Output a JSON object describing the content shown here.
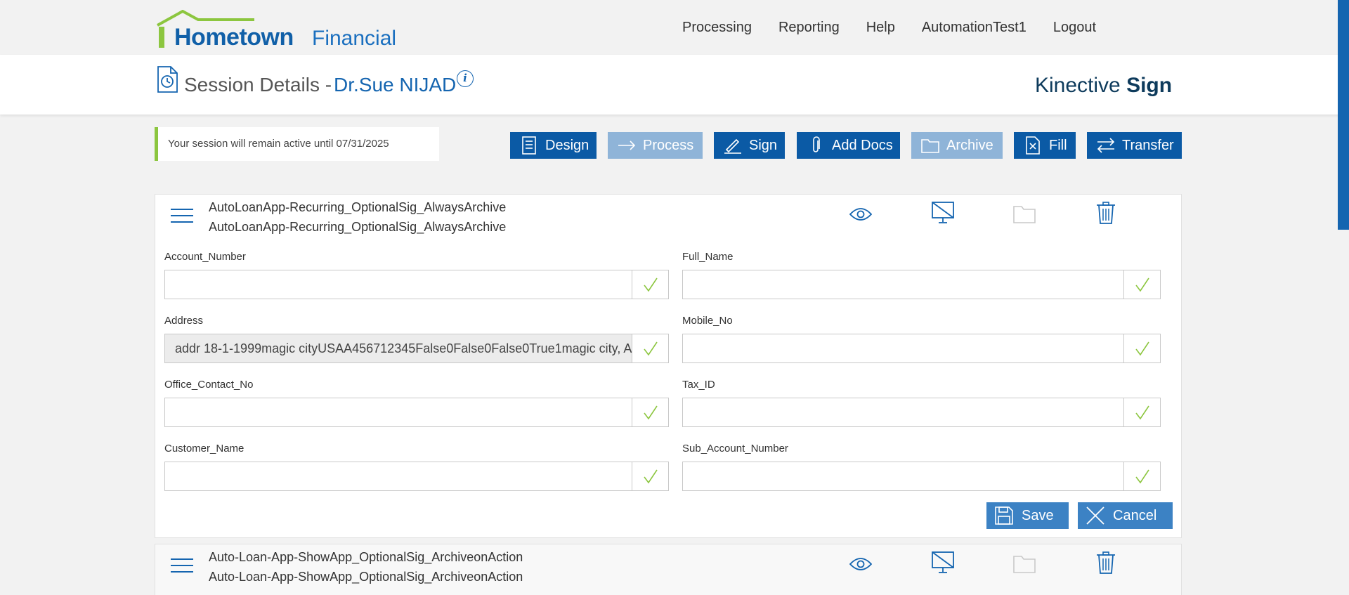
{
  "logo": {
    "word1": "Hometown",
    "word2": "Financial"
  },
  "nav": [
    "Processing",
    "Reporting",
    "Help",
    "AutomationTest1",
    "Logout"
  ],
  "header": {
    "title": "Session Details -",
    "name": "Dr.Sue NIJAD",
    "brand_light": "Kinective",
    "brand_bold": "Sign"
  },
  "notice": "Your session will remain active until 07/31/2025",
  "actions": {
    "design": "Design",
    "process": "Process",
    "sign": "Sign",
    "add_docs": "Add Docs",
    "archive": "Archive",
    "fill": "Fill",
    "transfer": "Transfer"
  },
  "doc1": {
    "title1": "AutoLoanApp-Recurring_OptionalSig_AlwaysArchive",
    "title2": "AutoLoanApp-Recurring_OptionalSig_AlwaysArchive"
  },
  "fields": {
    "account_number": {
      "label": "Account_Number",
      "value": ""
    },
    "full_name": {
      "label": "Full_Name",
      "value": ""
    },
    "address": {
      "label": "Address",
      "value": "addr 18-1-1999magic cityUSAA456712345False0False0False0True1magic city, A"
    },
    "mobile_no": {
      "label": "Mobile_No",
      "value": ""
    },
    "office_contact_no": {
      "label": "Office_Contact_No",
      "value": ""
    },
    "tax_id": {
      "label": "Tax_ID",
      "value": ""
    },
    "customer_name": {
      "label": "Customer_Name",
      "value": ""
    },
    "sub_account_number": {
      "label": "Sub_Account_Number",
      "value": ""
    }
  },
  "buttons": {
    "save": "Save",
    "cancel": "Cancel"
  },
  "doc2": {
    "title1": "Auto-Loan-App-ShowApp_OptionalSig_ArchiveonAction",
    "title2": "Auto-Loan-App-ShowApp_OptionalSig_ArchiveonAction"
  },
  "colors": {
    "primary": "#0b5aa5",
    "disabled": "#8fb4d8",
    "accent_green": "#8cc63f",
    "link_blue": "#1565b0"
  }
}
